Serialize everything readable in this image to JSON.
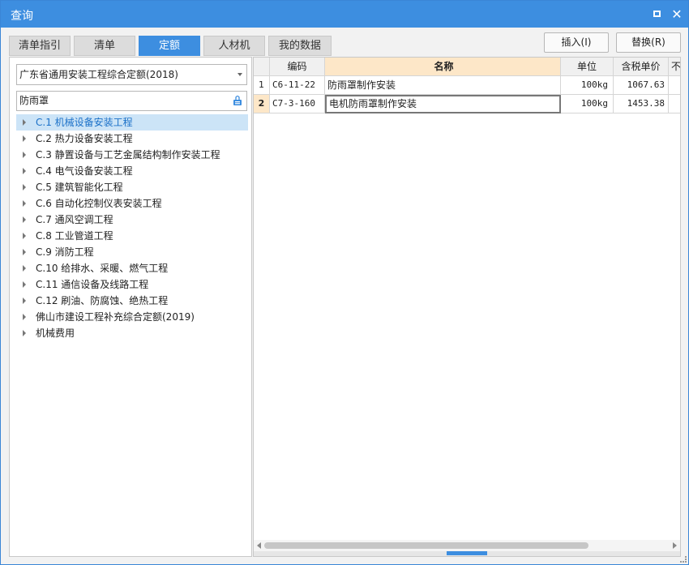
{
  "window": {
    "title": "查询"
  },
  "tabs": [
    "清单指引",
    "清单",
    "定额",
    "人材机",
    "我的数据"
  ],
  "toolbar": {
    "insert_label": "插入(I)",
    "replace_label": "替换(R)"
  },
  "left": {
    "library_select": "广东省通用安装工程综合定额(2018)",
    "search_value": "防雨罩",
    "tree": [
      "C.1 机械设备安装工程",
      "C.2 热力设备安装工程",
      "C.3 静置设备与工艺金属结构制作安装工程",
      "C.4 电气设备安装工程",
      "C.5 建筑智能化工程",
      "C.6 自动化控制仪表安装工程",
      "C.7 通风空调工程",
      "C.8 工业管道工程",
      "C.9 消防工程",
      "C.10 给排水、采暖、燃气工程",
      "C.11 通信设备及线路工程",
      "C.12 刷油、防腐蚀、绝热工程",
      "佛山市建设工程补充综合定额(2019)",
      "机械费用"
    ]
  },
  "grid": {
    "headers": {
      "code": "编码",
      "name": "名称",
      "unit": "单位",
      "price": "含税单价",
      "extra": "不"
    },
    "rows": [
      {
        "idx": "1",
        "code": "C6-11-22",
        "name": "防雨罩制作安装",
        "unit": "100kg",
        "price": "1067.63"
      },
      {
        "idx": "2",
        "code": "C7-3-160",
        "name": "电机防雨罩制作安装",
        "unit": "100kg",
        "price": "1453.38"
      }
    ]
  },
  "colors": {
    "accent": "#3d8ee0",
    "header_highlight": "#fde7c8",
    "selected_tree": "#cce4f7"
  }
}
